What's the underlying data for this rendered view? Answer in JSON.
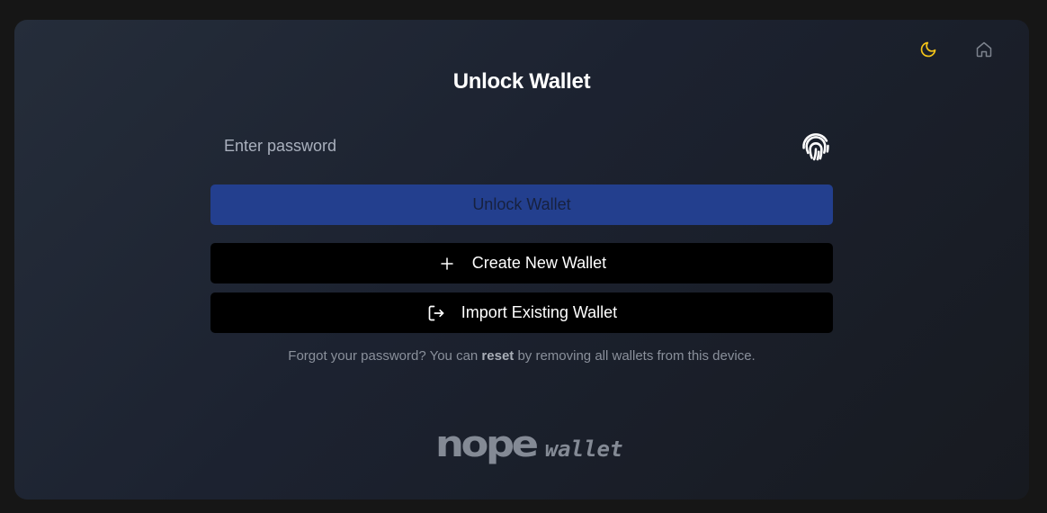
{
  "header": {
    "theme_icon": "moon-icon",
    "home_icon": "home-icon"
  },
  "title": "Unlock Wallet",
  "password": {
    "placeholder": "Enter password",
    "value": "",
    "biometric_icon": "fingerprint-icon"
  },
  "buttons": {
    "unlock_label": "Unlock Wallet",
    "create_label": "Create New Wallet",
    "create_icon": "plus-icon",
    "import_label": "Import Existing Wallet",
    "import_icon": "sign-in-icon"
  },
  "forgot": {
    "prefix": "Forgot your password? You can ",
    "link": "reset",
    "suffix": " by removing all wallets from this device."
  },
  "brand": {
    "name": "nope",
    "product": "wallet"
  },
  "colors": {
    "accent": "#233f8e",
    "theme_icon": "#f5c518",
    "background": "#1c2230"
  }
}
